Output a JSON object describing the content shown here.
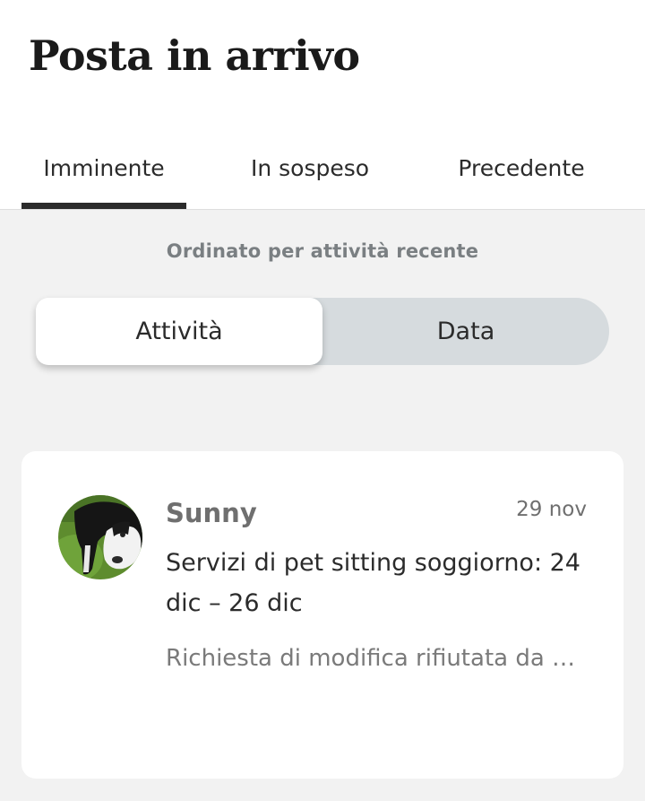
{
  "page": {
    "title": "Posta in arrivo"
  },
  "tabs": [
    {
      "label": "Imminente",
      "active": true
    },
    {
      "label": "In sospeso",
      "active": false
    },
    {
      "label": "Precedente",
      "active": false
    }
  ],
  "sort": {
    "label": "Ordinato per attività recente",
    "options": [
      {
        "label": "Attività",
        "selected": true
      },
      {
        "label": "Data",
        "selected": false
      }
    ]
  },
  "messages": [
    {
      "sender": "Sunny",
      "date": "29 nov",
      "subject": "Servizi di pet sitting soggiorno: 24 dic – 26 dic",
      "preview": "Richiesta di modifica rifiutata da …",
      "avatar": "dog-photo"
    }
  ],
  "colors": {
    "background": "#f2f2f2",
    "card": "#ffffff",
    "segment_track": "#d6dbde",
    "text_primary": "#2b2b2b",
    "text_secondary": "#7a7f82"
  }
}
